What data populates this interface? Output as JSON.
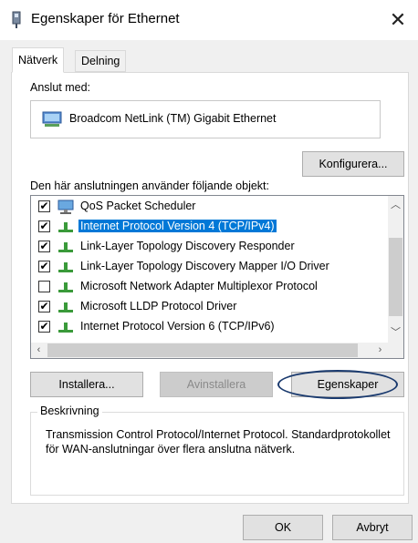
{
  "window": {
    "title": "Egenskaper för Ethernet",
    "close_icon": "close-icon"
  },
  "tabs": [
    {
      "label": "Nätverk",
      "active": true
    },
    {
      "label": "Delning",
      "active": false
    }
  ],
  "connect_using": {
    "label": "Anslut med:",
    "adapter": "Broadcom NetLink (TM) Gigabit Ethernet",
    "icon": "network-adapter-icon"
  },
  "configure_button": "Konfigurera...",
  "items_label": "Den här anslutningen använder följande objekt:",
  "items": [
    {
      "label": "QoS Packet Scheduler",
      "checked": true,
      "icon": "qos-scheduler-icon",
      "selected": false
    },
    {
      "label": "Internet Protocol Version 4 (TCP/IPv4)",
      "checked": true,
      "icon": "protocol-icon",
      "selected": true
    },
    {
      "label": "Link-Layer Topology Discovery Responder",
      "checked": true,
      "icon": "protocol-icon",
      "selected": false
    },
    {
      "label": "Link-Layer Topology Discovery Mapper I/O Driver",
      "checked": true,
      "icon": "protocol-icon",
      "selected": false
    },
    {
      "label": "Microsoft Network Adapter Multiplexor Protocol",
      "checked": false,
      "icon": "protocol-icon",
      "selected": false
    },
    {
      "label": "Microsoft LLDP Protocol Driver",
      "checked": true,
      "icon": "protocol-icon",
      "selected": false
    },
    {
      "label": "Internet Protocol Version 6 (TCP/IPv6)",
      "checked": true,
      "icon": "protocol-icon",
      "selected": false
    }
  ],
  "buttons": {
    "install": "Installera...",
    "uninstall": "Avinstallera",
    "properties": "Egenskaper"
  },
  "description": {
    "title": "Beskrivning",
    "text": "Transmission Control Protocol/Internet Protocol. Standardprotokollet för WAN-anslutningar över flera anslutna nätverk."
  },
  "dialog_buttons": {
    "ok": "OK",
    "cancel": "Avbryt"
  },
  "colors": {
    "selection": "#0078d7",
    "highlight_oval": "#1a3a6e"
  }
}
